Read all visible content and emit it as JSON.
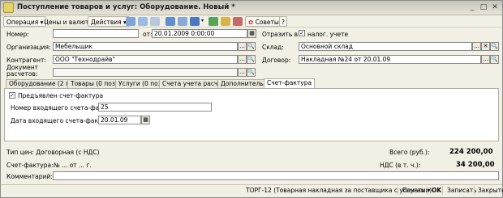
{
  "title": "Поступление товаров и услуг: Оборудование. Новый *",
  "toolbar": {
    "operation": "Операция",
    "prices": "Цены и валюта...",
    "actions": "Действия",
    "advice": "Советы",
    "help": "?"
  },
  "form": {
    "number_label": "Номер:",
    "number_value": "",
    "from_label": "от:",
    "date_value": "20.01.2009  0:00:00",
    "reflect_label": "Отразить в:",
    "tax_accounting_label": "налог. учете",
    "tax_accounting_checked": true,
    "organization_label": "Организация:",
    "organization_value": "Мебельщик",
    "warehouse_label": "Склад:",
    "warehouse_value": "Основной склад",
    "contractor_label": "Контрагент:",
    "contractor_value": "ООО \"Технодрайв\"",
    "contract_label": "Договор:",
    "contract_value": "Накладная №24 от 20.01.09",
    "settlement_doc_label_1": "Документ",
    "settlement_doc_label_2": "расчетов:",
    "settlement_doc_value": ""
  },
  "tabs": [
    {
      "label": "Оборудование (2 поз.)",
      "active": false
    },
    {
      "label": "Товары (0 поз.)",
      "active": false
    },
    {
      "label": "Услуги (0 поз.)",
      "active": false
    },
    {
      "label": "Счета учета расчетов",
      "active": false
    },
    {
      "label": "Дополнительно",
      "active": false
    },
    {
      "label": "Счет-фактура",
      "active": true
    }
  ],
  "invoice_tab": {
    "presented_label": "Предъявлен счет-фактура",
    "presented_checked": true,
    "incoming_number_label": "Номер входящего счета-фактуры:",
    "incoming_number_value": "25",
    "incoming_date_label": "Дата входящего счета-фактуры:",
    "incoming_date_value": "20.01.09"
  },
  "summary": {
    "price_type": "Тип цен: Договорная (с НДС)",
    "total_label": "Всего (руб.):",
    "total_value": "224 200,00",
    "invoice_label": "Счет-фактура:",
    "invoice_value": "№  ...  от  ...  г.",
    "vat_label": "НДС (в т. ч.):",
    "vat_value": "34 200,00",
    "comment_label": "Комментарий:",
    "comment_value": ""
  },
  "bottom": {
    "torg12": "ТОРГ-12 (Товарная накладная за поставщика с услугами)",
    "print": "Печать",
    "ok": "OK",
    "save": "Записать",
    "close": "Закрыть"
  }
}
